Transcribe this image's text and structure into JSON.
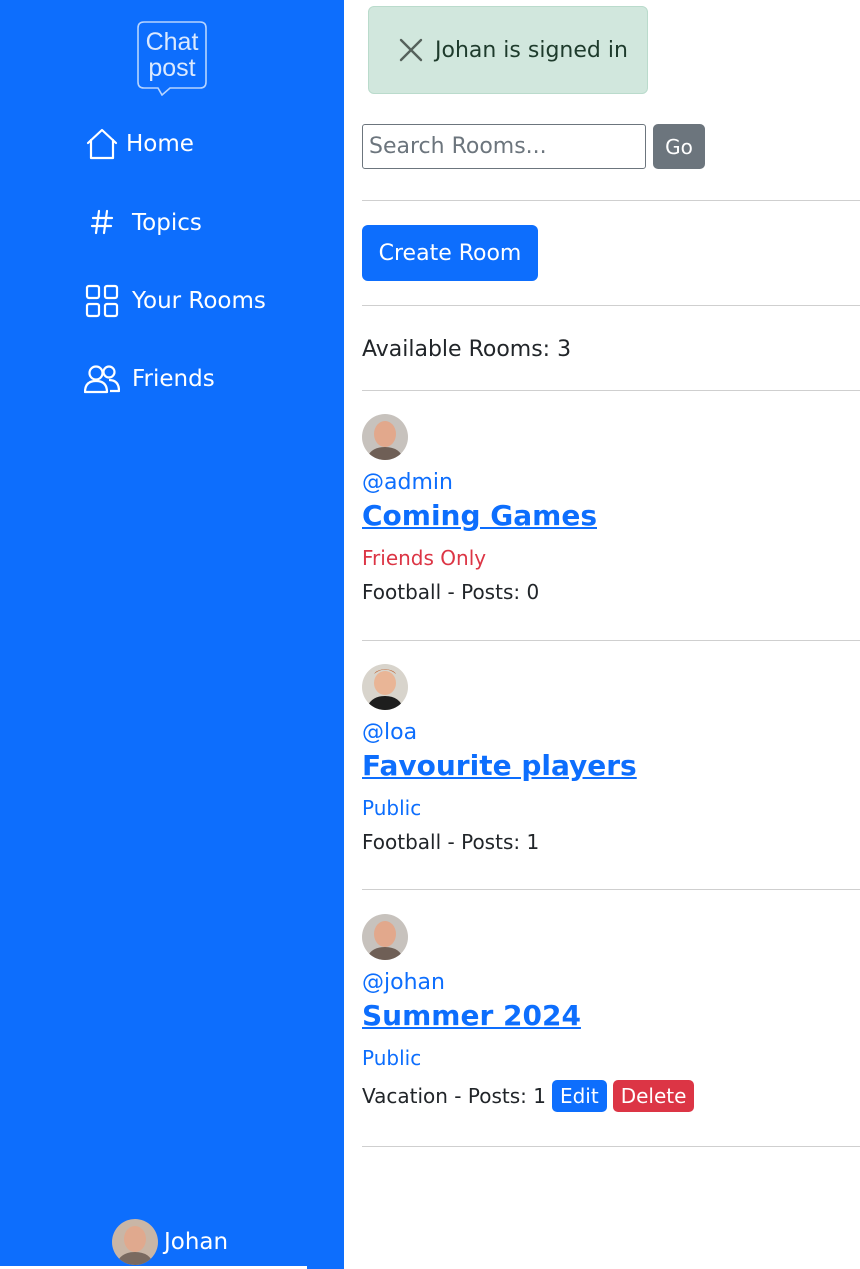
{
  "sidebar": {
    "logo_text_top": "Chat",
    "logo_text_bottom": "post",
    "items": [
      {
        "label": "Home",
        "icon": "house-icon"
      },
      {
        "label": "Topics",
        "icon": "hash-icon"
      },
      {
        "label": "Your Rooms",
        "icon": "grid-icon"
      },
      {
        "label": "Friends",
        "icon": "people-icon"
      }
    ],
    "user": {
      "name": "Johan"
    }
  },
  "alert": {
    "message": "Johan is signed in"
  },
  "search": {
    "placeholder": "Search Rooms...",
    "button_label": "Go"
  },
  "create_room_label": "Create Room",
  "available_rooms_text": "Available Rooms: 3",
  "rooms": [
    {
      "host": "@admin",
      "title": "Coming Games",
      "privacy": "Friends Only",
      "meta": "Football - Posts: 0"
    },
    {
      "host": "@loa",
      "title": "Favourite players",
      "privacy": "Public",
      "meta": "Football - Posts: 1"
    },
    {
      "host": "@johan",
      "title": "Summer 2024",
      "privacy": "Public",
      "meta": "Vacation - Posts: 1",
      "edit_label": "Edit",
      "delete_label": "Delete"
    }
  ],
  "colors": {
    "primary": "#0d6efd",
    "danger": "#dc3545",
    "secondary": "#6c757d",
    "success_bg": "#d1e7dd"
  }
}
